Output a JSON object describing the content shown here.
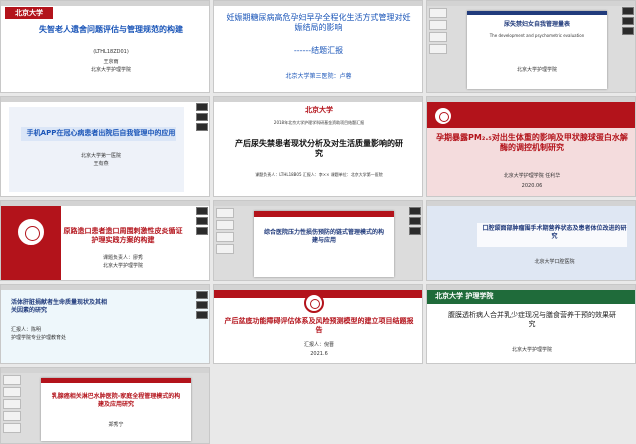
{
  "tiles": {
    "t1": {
      "logo": "北京大学",
      "title": "失智老人遗舍问题评估与管理规范的构建",
      "code": "(LTHL18ZD01)",
      "presenter": "王京雨",
      "org": "北京大学护理学院"
    },
    "t2": {
      "title": "妊娠期糖尿病高危孕妇早孕全程化生活方式管理对妊娠结局的影响",
      "subtitle": "------结题汇报",
      "org": "北京大学第三医院：卢蓉"
    },
    "t3": {
      "title_cn": "尿失禁妇女自我管理量表",
      "title_en": "The development and psychometric evaluation",
      "org": "北京大学护理学院"
    },
    "t4": {
      "title": "手机APP在冠心病患者出院后自我管理中的应用",
      "org": "北京大学第一医院",
      "presenter": "王有燕"
    },
    "t5": {
      "logo": "北京大学",
      "header": "2018年北京大学护理学科研基金资助项目结题汇报",
      "title": "产后尿失禁患者现状分析及对生活质量影响的研究",
      "row1": "课题负责人：LTHL18B05",
      "row2": "汇报人：李××",
      "row3": "课题单位：北京大学第一医院"
    },
    "t6": {
      "title": "孕期暴露PM₂.₅对出生体重的影响及甲状腺球蛋白水解酶的调控机制研究",
      "org": "北京大学护理学院",
      "presenter": "任利华",
      "date": "2020.06"
    },
    "t7": {
      "title": "原路造口患者造口周围刺激性皮炎循证护理实践方案的构建",
      "presenter": "课题负责人：廖秀",
      "org": "北京大学护理学院"
    },
    "t8": {
      "title": "综合医院压力性损伤预防的链式管理模式的构建与应用"
    },
    "t9": {
      "title": "口腔颌面部肿瘤围手术期营养状态及患者体位改进的研究",
      "org": "北京大学口腔医院"
    },
    "t10": {
      "title": "活体肝脏捐献者生命质量现状及其相关因素的研究",
      "presenter": "汇报人：陈明",
      "org": "护理学院专业护理教育处"
    },
    "t11": {
      "title": "产后盆底功能障碍评估体系及风险预测模型的建立项目结题报告",
      "presenter": "汇报人：倪晋",
      "date": "2021.6"
    },
    "t12": {
      "logo": "北京大学 护理学院",
      "title": "腹膜透析病人合并乳少症现况与膳食营养干预的效果研究",
      "org": "北京大学护理学院"
    },
    "t13": {
      "title": "乳腺癌相关淋巴水肿医院-家庭全程管理模式的构建及应用研究",
      "presenter": "郑秀宁"
    }
  },
  "colors": {
    "accent_red": "#b3131b",
    "accent_blue": "#1a55b8",
    "navy": "#213b7c"
  },
  "icons": [
    "camera-feed-icon",
    "slide-thumbnail-icon"
  ]
}
